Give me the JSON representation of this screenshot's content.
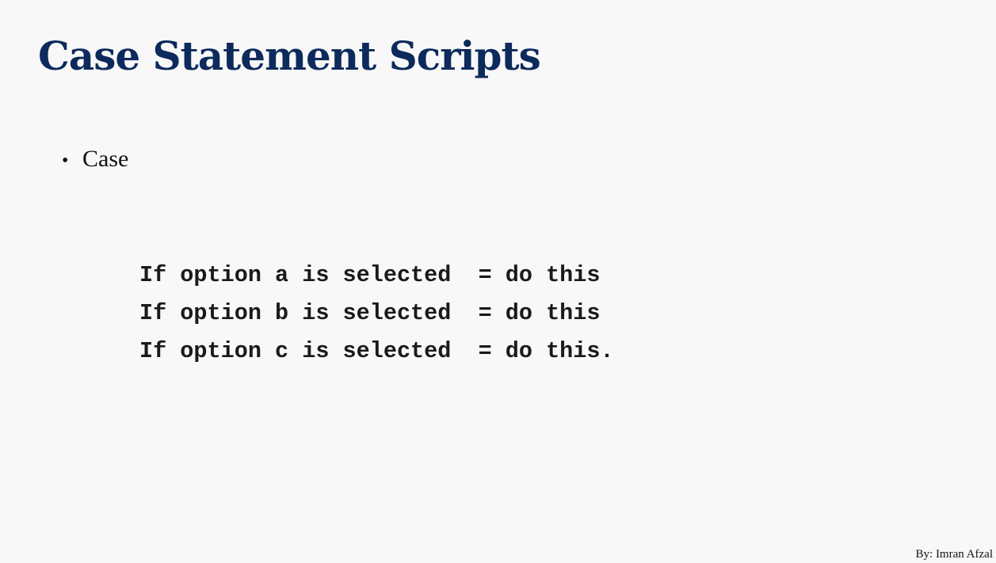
{
  "slide": {
    "title": "Case Statement Scripts",
    "title_color": "#0d2a5c",
    "bullets": [
      {
        "text": "Case"
      }
    ],
    "bullet_glyph": "•",
    "code_lines": [
      "If option a is selected  = do this",
      "If option b is selected  = do this",
      "If option c is selected  = do this."
    ],
    "footer": "By: Imran Afzal"
  }
}
